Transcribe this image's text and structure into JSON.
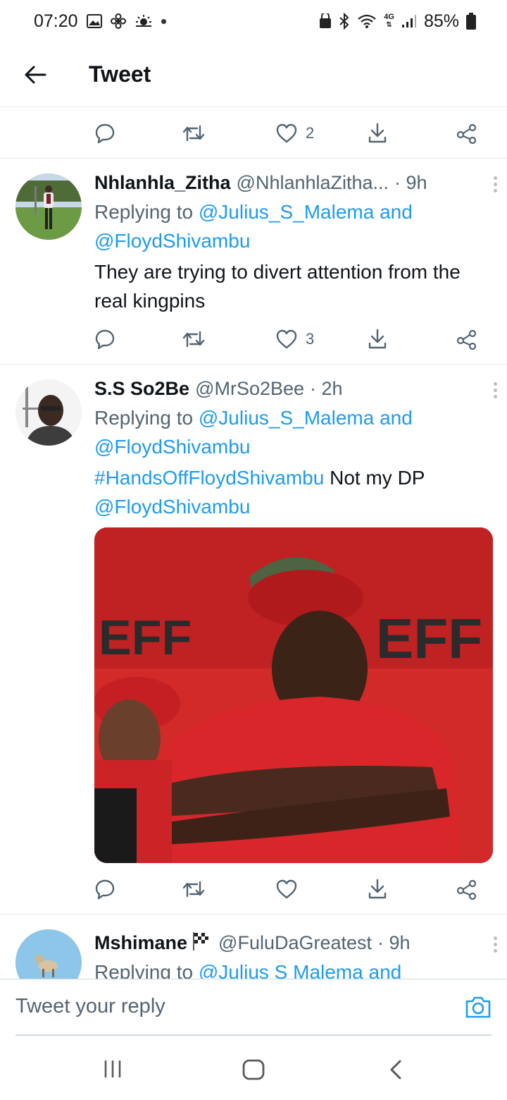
{
  "status_bar": {
    "time": "07:20",
    "network": "4G",
    "battery": "85%"
  },
  "header": {
    "title": "Tweet"
  },
  "top_actions": {
    "like_count": "2"
  },
  "tweets": [
    {
      "name": "Nhlanhla_Zitha",
      "handle": "@NhlanhlaZitha...",
      "time": "· 9h",
      "replying_prefix": "Replying to ",
      "replying_user1": "@Julius_S_Malema",
      "replying_and": " and",
      "replying_user2": "@FloydShivambu",
      "text": "They are trying to divert attention from the real kingpins",
      "like_count": "3"
    },
    {
      "name": "S.S So2Be",
      "handle": "@MrSo2Bee",
      "time": "· 2h",
      "replying_prefix": "Replying to ",
      "replying_user1": "@Julius_S_Malema",
      "replying_and": " and",
      "replying_user2": "@FloydShivambu",
      "hashtag": "#HandsOffFloydShivambu",
      "text_after": " Not my DP",
      "mention": "@FloydShivambu",
      "image_text_left": "EFF",
      "image_text_right": "EFF"
    },
    {
      "name": "Mshimane",
      "handle": "@FuluDaGreatest",
      "time": "· 9h",
      "replying_prefix": "Replying to ",
      "replying_user1": "@Julius S Malema",
      "replying_and": " and"
    }
  ],
  "reply_bar": {
    "placeholder": "Tweet your reply"
  },
  "colors": {
    "link": "#1d9bf0",
    "muted": "#536471",
    "image_red": "#d12a28"
  }
}
